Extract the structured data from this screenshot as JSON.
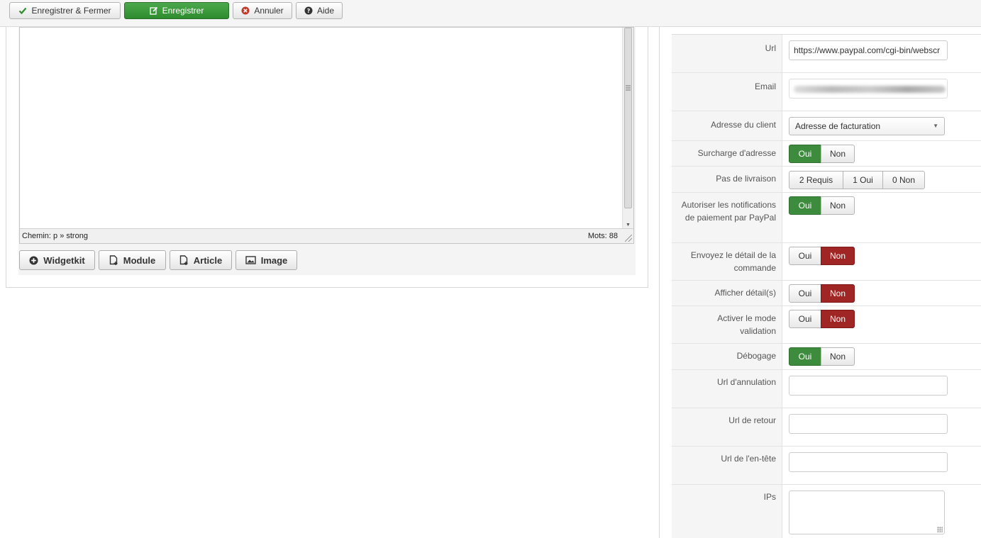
{
  "toolbar": {
    "save_close": "Enregistrer & Fermer",
    "save": "Enregistrer",
    "cancel": "Annuler",
    "help": "Aide"
  },
  "editor": {
    "path": "Chemin:  p » strong",
    "words": "Mots: 88",
    "buttons": {
      "widgetkit": "Widgetkit",
      "module": "Module",
      "article": "Article",
      "image": "Image"
    }
  },
  "form": {
    "url": {
      "label": "Url",
      "value": "https://www.paypal.com/cgi-bin/webscr"
    },
    "email": {
      "label": "Email"
    },
    "client_address": {
      "label": "Adresse du client",
      "value": "Adresse de facturation"
    },
    "address_override": {
      "label": "Surcharge d'adresse",
      "yes": "Oui",
      "no": "Non",
      "selected": "yes"
    },
    "no_shipping": {
      "label": "Pas de livraison",
      "options": [
        "2 Requis",
        "1 Oui",
        "0 Non"
      ]
    },
    "ipn": {
      "label": "Autoriser les notifications de paiement par PayPal",
      "yes": "Oui",
      "no": "Non",
      "selected": "yes"
    },
    "send_order_detail": {
      "label": "Envoyez le détail de la commande",
      "yes": "Oui",
      "no": "Non",
      "selected": "no"
    },
    "show_details": {
      "label": "Afficher détail(s)",
      "yes": "Oui",
      "no": "Non",
      "selected": "no"
    },
    "validation_mode": {
      "label": "Activer le mode validation",
      "yes": "Oui",
      "no": "Non",
      "selected": "no"
    },
    "debug": {
      "label": "Débogage",
      "yes": "Oui",
      "no": "Non",
      "selected": "yes"
    },
    "cancel_url": {
      "label": "Url d'annulation",
      "value": ""
    },
    "return_url": {
      "label": "Url de retour",
      "value": ""
    },
    "header_url": {
      "label": "Url de l'en-tête",
      "value": ""
    },
    "ips": {
      "label": "IPs",
      "value": ""
    }
  },
  "colors": {
    "green": "#3d8c3d",
    "red": "#a02525"
  }
}
